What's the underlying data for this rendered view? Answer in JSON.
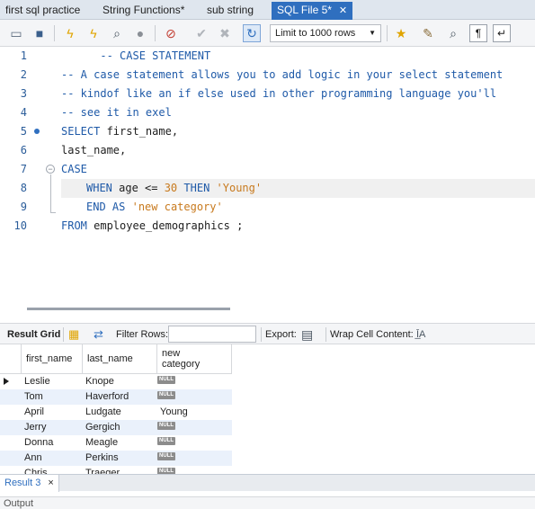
{
  "tabs": [
    {
      "label": "first sql practice",
      "active": false
    },
    {
      "label": "String Functions*",
      "active": false
    },
    {
      "label": "sub string",
      "active": false
    },
    {
      "label": "SQL File 5*",
      "active": true
    }
  ],
  "toolbar": {
    "icons": [
      "open-folder-icon",
      "save-icon",
      "execute-icon",
      "execute-current-icon",
      "explain-icon",
      "stop-icon",
      "toggle-error-icon",
      "commit-icon",
      "rollback-icon",
      "autocommit-icon",
      "add-snippet-icon",
      "beautify-icon",
      "find-icon",
      "invisibles-icon",
      "wrap-icon"
    ],
    "limit_label": "Limit to 1000 rows"
  },
  "editor": {
    "lines": [
      {
        "n": "1",
        "text": "      -- CASE STATEMENT"
      },
      {
        "n": "2",
        "text": "-- A case statement allows you to add logic in your select statement"
      },
      {
        "n": "3",
        "text": "-- kindof like an if else used in other programming language you'll"
      },
      {
        "n": "4",
        "text": "-- see it in exel"
      },
      {
        "n": "5",
        "kw": "SELECT",
        "rest": " first_name,"
      },
      {
        "n": "6",
        "text": "last_name,"
      },
      {
        "n": "7",
        "text": "CASE"
      },
      {
        "n": "8",
        "kw1": "WHEN",
        "mid1": " age <= ",
        "num": "30",
        "mid2": " ",
        "kw2": "THEN",
        "mid3": " ",
        "str": "'Young'"
      },
      {
        "n": "9",
        "kw1": "END",
        "mid1": " ",
        "kw2": "AS",
        "mid2": " ",
        "str": "'new category'"
      },
      {
        "n": "10",
        "kw": "FROM",
        "rest": " employee_demographics ;"
      }
    ]
  },
  "result_toolbar": {
    "result_grid": "Result Grid",
    "filter_rows": "Filter Rows:",
    "filter_value": "",
    "export": "Export:",
    "wrap_cell": "Wrap Cell Content:"
  },
  "grid": {
    "columns": [
      "first_name",
      "last_name",
      "new category"
    ],
    "null_text": "NULL",
    "rows": [
      [
        "Leslie",
        "Knope",
        null
      ],
      [
        "Tom",
        "Haverford",
        null
      ],
      [
        "April",
        "Ludgate",
        "Young"
      ],
      [
        "Jerry",
        "Gergich",
        null
      ],
      [
        "Donna",
        "Meagle",
        null
      ],
      [
        "Ann",
        "Perkins",
        null
      ],
      [
        "Chris",
        "Traeger",
        null
      ]
    ]
  },
  "result_tab": {
    "label": "Result 3",
    "close": "×"
  },
  "output": {
    "label": "Output"
  },
  "colors": {
    "accent": "#2f6fbf",
    "keyword": "#1f5aa8",
    "string": "#c87a1e"
  }
}
